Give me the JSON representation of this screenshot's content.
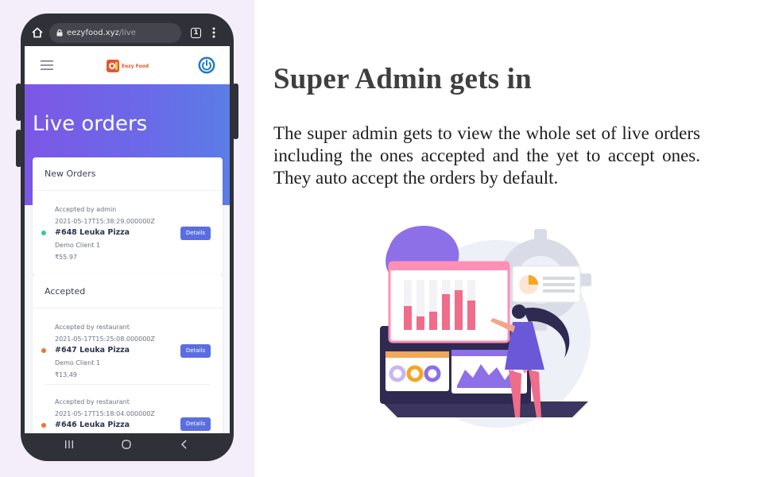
{
  "browser": {
    "url_host": "eezyfood.xyz",
    "url_path": "/live",
    "tab_count": "1"
  },
  "app": {
    "logo_text": "Eezy Food"
  },
  "page": {
    "title": "Live orders"
  },
  "sections": [
    {
      "heading": "New Orders",
      "orders": [
        {
          "status": "Accepted by admin",
          "timestamp": "2021-05-17T15:38:29.000000Z",
          "title": "#648 Leuka Pizza",
          "client": "Demo Client 1",
          "price": "₹55.97",
          "dot_color": "#2ecc9a",
          "button": "Details"
        }
      ]
    },
    {
      "heading": "Accepted",
      "orders": [
        {
          "status": "Accepted by restaurant",
          "timestamp": "2021-05-17T15:25:08.000000Z",
          "title": "#647 Leuka Pizza",
          "client": "Demo Client 1",
          "price": "₹13.49",
          "dot_color": "#f0713b",
          "button": "Details"
        },
        {
          "status": "Accepted by restaurant",
          "timestamp": "2021-05-17T15:18:04.000000Z",
          "title": "#646 Leuka Pizza",
          "client": "",
          "price": "",
          "dot_color": "#f0713b",
          "button": "Details"
        }
      ]
    }
  ],
  "slide": {
    "heading": "Super Admin gets in",
    "body": "The super admin gets to view the whole set of live orders including the ones accepted and the yet to accept ones. They auto accept the orders by default."
  },
  "colors": {
    "accent": "#5b6ee1",
    "hero_start": "#7d57e6",
    "hero_end": "#5b7de6",
    "new_dot": "#2ecc9a",
    "accepted_dot": "#f0713b"
  }
}
